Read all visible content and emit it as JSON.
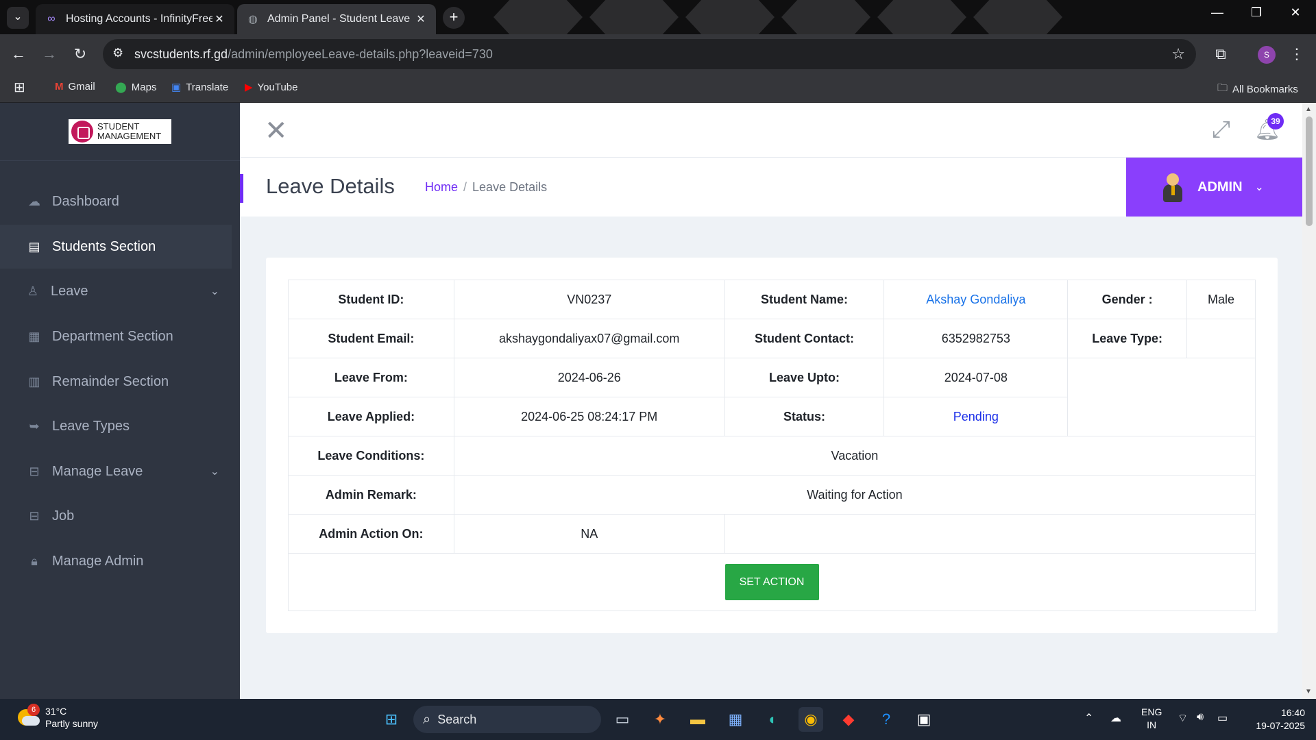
{
  "browser": {
    "tabs": [
      {
        "title": "Hosting Accounts - InfinityFree",
        "icon": "infinity-icon",
        "active": false
      },
      {
        "title": "Admin Panel - Student Leave",
        "icon": "globe-icon",
        "active": true
      }
    ],
    "url": {
      "domain": "svcstudents.rf.gd",
      "path": "/admin/employeeLeave-details.php?leaveid=730"
    },
    "profile_initial": "S",
    "bookmarks": [
      {
        "label": "Gmail",
        "icon": "gmail-icon"
      },
      {
        "label": "Maps",
        "icon": "maps-icon"
      },
      {
        "label": "Translate",
        "icon": "translate-icon"
      },
      {
        "label": "YouTube",
        "icon": "youtube-icon"
      }
    ],
    "all_bookmarks": "All Bookmarks"
  },
  "sidebar": {
    "logo_line1": "STUDENT",
    "logo_line2": "MANAGEMENT",
    "items": [
      {
        "label": "Dashboard",
        "icon": "dashboard-icon"
      },
      {
        "label": "Students Section",
        "icon": "id-card-icon",
        "active": true
      },
      {
        "label": "Leave",
        "icon": "user-icon",
        "has_submenu": true
      },
      {
        "label": "Department Section",
        "icon": "grid-icon"
      },
      {
        "label": "Remainder Section",
        "icon": "calendar-icon"
      },
      {
        "label": "Leave Types",
        "icon": "sign-out-icon"
      },
      {
        "label": "Manage Leave",
        "icon": "briefcase-icon",
        "has_submenu": true
      },
      {
        "label": "Job",
        "icon": "briefcase-icon"
      },
      {
        "label": "Manage Admin",
        "icon": "lock-icon"
      }
    ]
  },
  "header": {
    "notification_count": "39",
    "page_title": "Leave Details",
    "breadcrumb": {
      "home": "Home",
      "separator": "/",
      "current": "Leave Details"
    },
    "admin_label": "ADMIN"
  },
  "details": {
    "student_id_label": "Student ID:",
    "student_id": "VN0237",
    "student_name_label": "Student Name:",
    "student_name": "Akshay Gondaliya",
    "gender_label": "Gender :",
    "gender": "Male",
    "email_label": "Student Email:",
    "email": "akshaygondaliyax07@gmail.com",
    "contact_label": "Student Contact:",
    "contact": "6352982753",
    "leave_type_label": "Leave Type:",
    "leave_type": "",
    "leave_from_label": "Leave From:",
    "leave_from": "2024-06-26",
    "leave_upto_label": "Leave Upto:",
    "leave_upto": "2024-07-08",
    "applied_label": "Leave Applied:",
    "applied": "2024-06-25 08:24:17 PM",
    "status_label": "Status:",
    "status": "Pending",
    "conditions_label": "Leave Conditions:",
    "conditions": "Vacation",
    "remark_label": "Admin Remark:",
    "remark": "Waiting for Action",
    "action_on_label": "Admin Action On:",
    "action_on": "NA",
    "set_action_label": "SET ACTION"
  },
  "colors": {
    "accent": "#8a3ffc",
    "sidebar_bg": "#2f3541",
    "button_green": "#28a745",
    "link_blue": "#1a73e8"
  },
  "taskbar": {
    "weather_badge": "6",
    "temperature": "31°C",
    "condition": "Partly sunny",
    "search_label": "Search",
    "language_line1": "ENG",
    "language_line2": "IN",
    "time": "16:40",
    "date": "19-07-2025"
  }
}
